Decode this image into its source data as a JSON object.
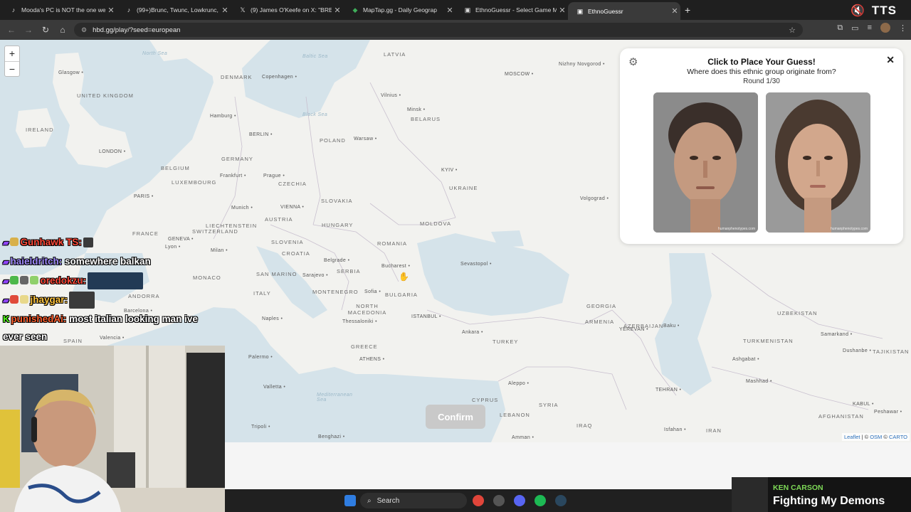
{
  "browser": {
    "tabs": [
      {
        "label": "Mooda's PC is NOT the one we",
        "icon": "tiktok-icon",
        "active": false
      },
      {
        "label": "(99+)Brunc, Twunc, Lowkrunc, L",
        "icon": "tiktok-icon",
        "active": false
      },
      {
        "label": "(9) James O'Keefe on X: \"BREAK",
        "icon": "x-icon",
        "active": false
      },
      {
        "label": "MapTap.gg - Daily Geograp",
        "icon": "maptap-icon",
        "active": false
      },
      {
        "label": "EthnoGuessr - Select Game Mo",
        "icon": "ethnoguessr-icon",
        "active": false
      },
      {
        "label": "EthnoGuessr",
        "icon": "ethnoguessr-icon",
        "active": true
      }
    ],
    "url": "hbd.gg/play/?seed=european",
    "tts_label": "TTS"
  },
  "map": {
    "zoom_in": "+",
    "zoom_out": "−",
    "countries": [
      {
        "name": "LATVIA"
      },
      {
        "name": "DENMARK"
      },
      {
        "name": "UNITED KINGDOM"
      },
      {
        "name": "IRELAND"
      },
      {
        "name": "BELARUS"
      },
      {
        "name": "POLAND"
      },
      {
        "name": "GERMANY"
      },
      {
        "name": "BELGIUM"
      },
      {
        "name": "LUXEMBOURG"
      },
      {
        "name": "CZECHIA"
      },
      {
        "name": "UKRAINE"
      },
      {
        "name": "SLOVAKIA"
      },
      {
        "name": "FRANCE"
      },
      {
        "name": "SWITZERLAND"
      },
      {
        "name": "LIECHTENSTEIN"
      },
      {
        "name": "AUSTRIA"
      },
      {
        "name": "HUNGARY"
      },
      {
        "name": "MOLDOVA"
      },
      {
        "name": "ROMANIA"
      },
      {
        "name": "SLOVENIA"
      },
      {
        "name": "CROATIA"
      },
      {
        "name": "SERBIA"
      },
      {
        "name": "MONACO"
      },
      {
        "name": "SAN MARINO"
      },
      {
        "name": "ITALY"
      },
      {
        "name": "MONTENEGRO"
      },
      {
        "name": "BULGARIA"
      },
      {
        "name": "NORTH MACEDONIA"
      },
      {
        "name": "ANDORRA"
      },
      {
        "name": "SPAIN"
      },
      {
        "name": "GREECE"
      },
      {
        "name": "TURKEY"
      },
      {
        "name": "ARMENIA"
      },
      {
        "name": "AZERBAIJAN"
      },
      {
        "name": "GEORGIA"
      },
      {
        "name": "UZBEKISTAN"
      },
      {
        "name": "TURKMENISTAN"
      },
      {
        "name": "TAJIKISTAN"
      },
      {
        "name": "SYRIA"
      },
      {
        "name": "CYPRUS"
      },
      {
        "name": "LEBANON"
      },
      {
        "name": "IRAQ"
      },
      {
        "name": "IRAN"
      },
      {
        "name": "AFGHANISTAN"
      }
    ],
    "cities": [
      {
        "name": "Glasgow"
      },
      {
        "name": "Copenhagen"
      },
      {
        "name": "Vilnius"
      },
      {
        "name": "MOSCOW"
      },
      {
        "name": "Nizhny Novgorod"
      },
      {
        "name": "Hamburg"
      },
      {
        "name": "Minsk"
      },
      {
        "name": "BERLIN"
      },
      {
        "name": "Warsaw"
      },
      {
        "name": "LONDON"
      },
      {
        "name": "Frankfurt"
      },
      {
        "name": "Prague"
      },
      {
        "name": "KYIV"
      },
      {
        "name": "PARIS"
      },
      {
        "name": "Munich"
      },
      {
        "name": "VIENNA"
      },
      {
        "name": "Volgograd"
      },
      {
        "name": "GENEVA"
      },
      {
        "name": "Lyon"
      },
      {
        "name": "Milan"
      },
      {
        "name": "Belgrade"
      },
      {
        "name": "Bucharest"
      },
      {
        "name": "Sevastopol"
      },
      {
        "name": "Sarajevo"
      },
      {
        "name": "Sofia"
      },
      {
        "name": "Barcelona"
      },
      {
        "name": "Naples"
      },
      {
        "name": "ISTANBUL"
      },
      {
        "name": "Thessaloniki"
      },
      {
        "name": "Ankara"
      },
      {
        "name": "YEREVAN"
      },
      {
        "name": "Baku"
      },
      {
        "name": "Valencia"
      },
      {
        "name": "Palermo"
      },
      {
        "name": "ATHENS"
      },
      {
        "name": "Samarkand"
      },
      {
        "name": "Dushanbe"
      },
      {
        "name": "Ashgabat"
      },
      {
        "name": "Mashhad"
      },
      {
        "name": "Aleppo"
      },
      {
        "name": "TEHRAN"
      },
      {
        "name": "Valletta"
      },
      {
        "name": "Tripoli"
      },
      {
        "name": "Benghazi"
      },
      {
        "name": "Amman"
      },
      {
        "name": "Isfahan"
      },
      {
        "name": "KABUL"
      },
      {
        "name": "Peshawar"
      }
    ],
    "seas": [
      {
        "name": "North Sea"
      },
      {
        "name": "Mediterranean Sea"
      },
      {
        "name": "Baltic Sea"
      },
      {
        "name": "Black Sea"
      }
    ],
    "confirm_label": "Confirm",
    "attribution": {
      "leaflet": "Leaflet",
      "sep": " | © ",
      "osm": "OSM",
      "mid": " © ",
      "carto": "CARTO"
    }
  },
  "panel": {
    "title": "Click to Place Your Guess!",
    "subtitle": "Where does this ethnic group originate from?",
    "round": "Round 1/30",
    "watermark": "humanphenotypes.com"
  },
  "chat": {
    "messages": [
      {
        "user": "Gunhawk TS:",
        "text": ""
      },
      {
        "user": "haieldritch:",
        "text": " somewhere balkan"
      },
      {
        "user": "oredokzu:",
        "text": ""
      },
      {
        "user": "jhaygar:",
        "text": ""
      },
      {
        "user": "punishedAi:",
        "text": " most italian looking man ive ever seen"
      }
    ]
  },
  "taskbar": {
    "search": "Search"
  },
  "now_playing": {
    "artist": "KEN CARSON",
    "song": "Fighting My Demons"
  }
}
